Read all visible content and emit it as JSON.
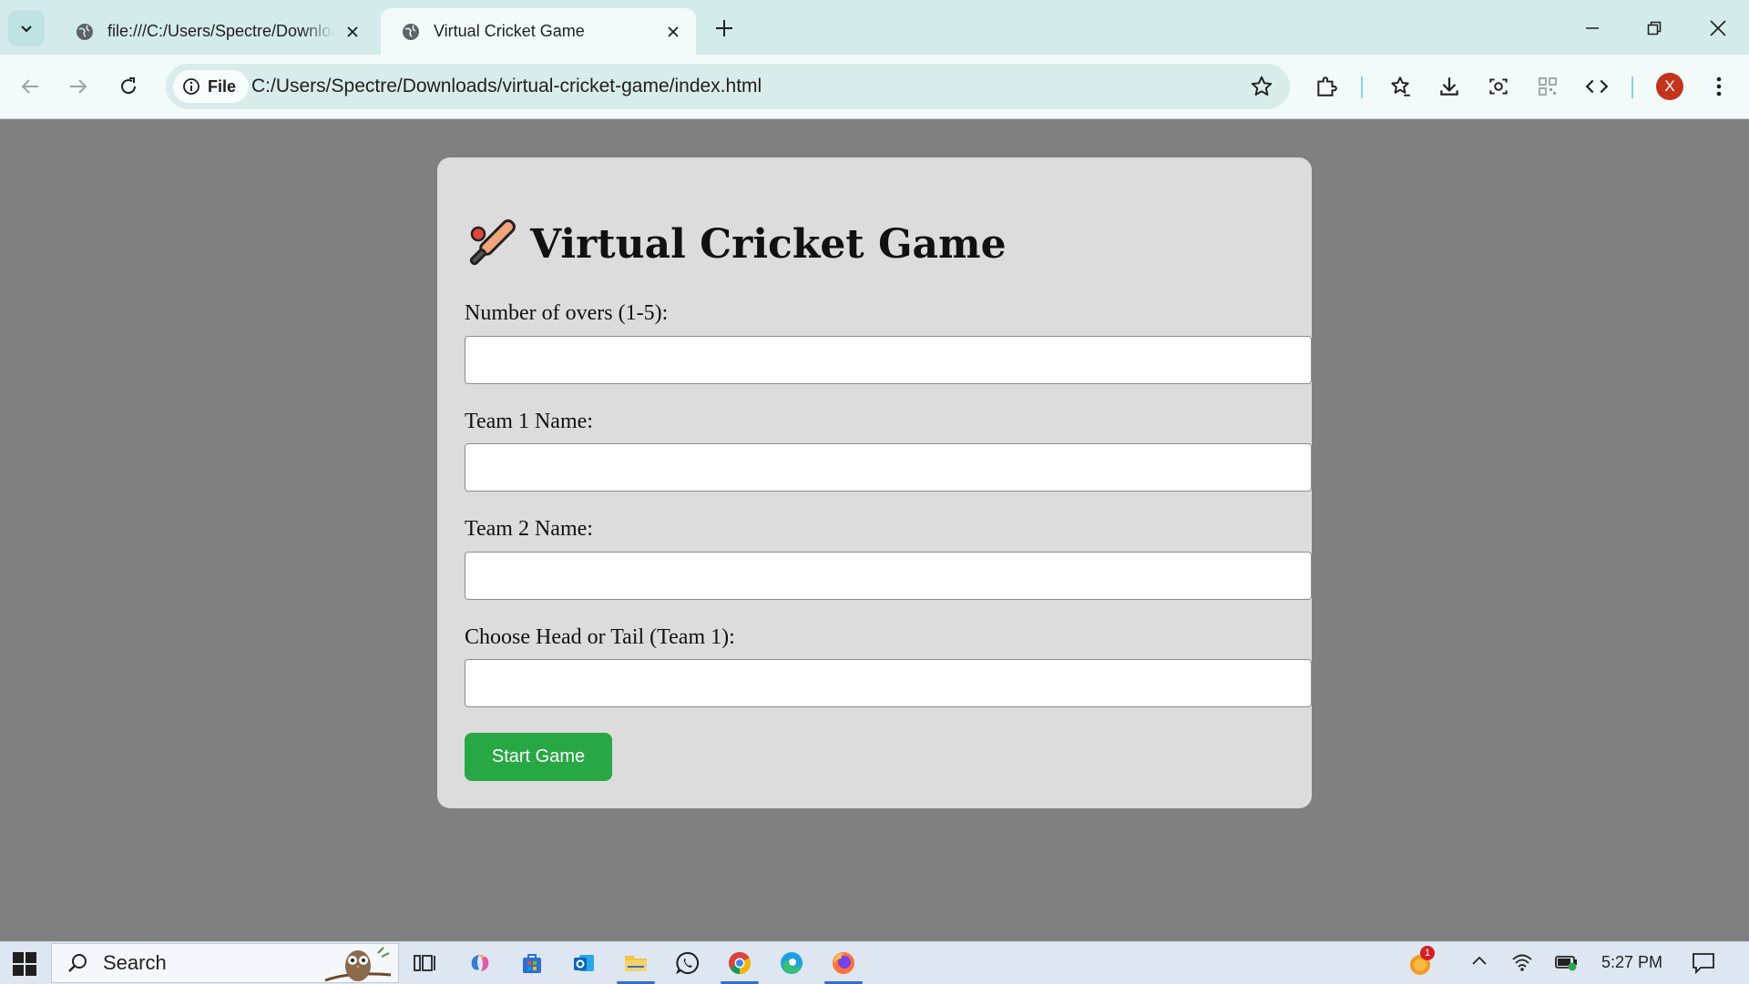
{
  "browser": {
    "tabs": [
      {
        "title": "file:///C:/Users/Spectre/Downloads/virtual-cricket-game/index.html",
        "active": false
      },
      {
        "title": "Virtual Cricket Game",
        "active": true
      }
    ],
    "address": {
      "chip_label": "File",
      "url": "C:/Users/Spectre/Downloads/virtual-cricket-game/index.html"
    },
    "profile_initial": "X"
  },
  "page": {
    "heading_icon": "cricket-bat-icon",
    "heading": "Virtual Cricket Game",
    "fields": [
      {
        "label": "Number of overs (1-5):",
        "value": ""
      },
      {
        "label": "Team 1 Name:",
        "value": ""
      },
      {
        "label": "Team 2 Name:",
        "value": ""
      },
      {
        "label": "Choose Head or Tail (Team 1):",
        "value": ""
      }
    ],
    "start_button": "Start Game",
    "colors": {
      "card_bg": "#dcdcdc",
      "page_bg": "#808080",
      "button_bg": "#28a745"
    }
  },
  "taskbar": {
    "search_label": "Search",
    "clock": "5:27 PM",
    "notification_count": "1",
    "apps": [
      "task-view-icon",
      "copilot-icon",
      "store-icon",
      "outlook-icon",
      "file-explorer-icon",
      "whatsapp-icon",
      "chrome-icon",
      "edge-icon",
      "firefox-icon"
    ]
  }
}
